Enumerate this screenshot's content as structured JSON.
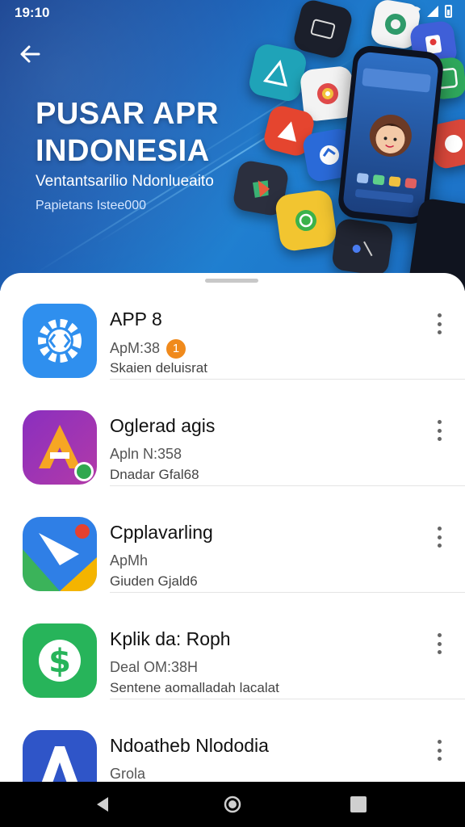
{
  "status_bar": {
    "time": "19:10"
  },
  "hero": {
    "title_line1": "PUSAR APR",
    "title_line2": "INDONESIA",
    "subtitle": "Ventantsarilio Ndonlueaito",
    "caption": "Papietans Istee000"
  },
  "apps": [
    {
      "name": "APP 8",
      "meta": "ApM:38",
      "badge": "1",
      "desc": "Skaien deluisrat"
    },
    {
      "name": "Oglerad agis",
      "meta": "Apln N:358",
      "desc": "Dnadar Gfal68"
    },
    {
      "name": "Cpplavarling",
      "meta": "ApMh",
      "desc": "Giuden Gjald6"
    },
    {
      "name": "Kplik da: Roph",
      "meta": "Deal OM:38H",
      "desc": "Sentene aomalladah lacalat"
    },
    {
      "name": "Ndoatheb Nlododia",
      "meta": "Grola",
      "desc": ""
    }
  ],
  "icons": {
    "back": "arrow-left-icon",
    "more": "more-vert-icon",
    "nav_back": "triangle-back-icon",
    "nav_home": "circle-home-icon",
    "nav_recents": "square-recents-icon"
  },
  "colors": {
    "accent": "#1a6fd0",
    "badge": "#f08a1c"
  }
}
